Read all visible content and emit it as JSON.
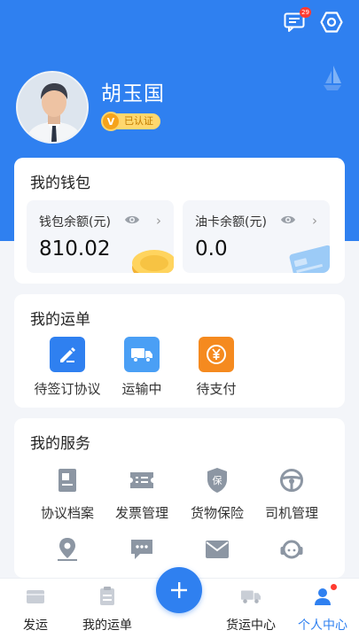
{
  "header": {
    "message_badge": "29",
    "user_name": "胡玉国",
    "verified_label": "已认证",
    "verified_badge_letter": "V",
    "accent_color": "#2f80f0"
  },
  "wallet": {
    "title": "我的钱包",
    "balance_label": "钱包余额(元)",
    "balance_value": "810.02",
    "fuel_label": "油卡余额(元)",
    "fuel_value": "0.0",
    "arrow": "›"
  },
  "orders": {
    "title": "我的运单",
    "items": [
      {
        "label": "待签订协议",
        "icon": "edit-document-icon",
        "color": "#2f80f0"
      },
      {
        "label": "运输中",
        "icon": "truck-icon",
        "color": "#4a9ff5"
      },
      {
        "label": "待支付",
        "icon": "yuan-icon",
        "color": "#f58a1f"
      }
    ]
  },
  "services": {
    "title": "我的服务",
    "items": [
      {
        "label": "协议档案",
        "icon": "archive-icon"
      },
      {
        "label": "发票管理",
        "icon": "invoice-icon"
      },
      {
        "label": "货物保险",
        "icon": "insurance-shield-icon"
      },
      {
        "label": "司机管理",
        "icon": "steering-wheel-icon"
      },
      {
        "label": "",
        "icon": "location-pin-icon"
      },
      {
        "label": "",
        "icon": "chat-bubble-icon"
      },
      {
        "label": "",
        "icon": "mail-icon"
      },
      {
        "label": "",
        "icon": "customer-service-icon"
      }
    ]
  },
  "tabbar": {
    "items": [
      {
        "label": "发运",
        "icon": "ship-box-icon",
        "active": false
      },
      {
        "label": "我的运单",
        "icon": "waybill-icon",
        "active": false
      },
      {
        "label": "货运中心",
        "icon": "truck-tab-icon",
        "active": false
      },
      {
        "label": "个人中心",
        "icon": "person-icon",
        "active": true
      }
    ],
    "fab_symbol": "+"
  }
}
